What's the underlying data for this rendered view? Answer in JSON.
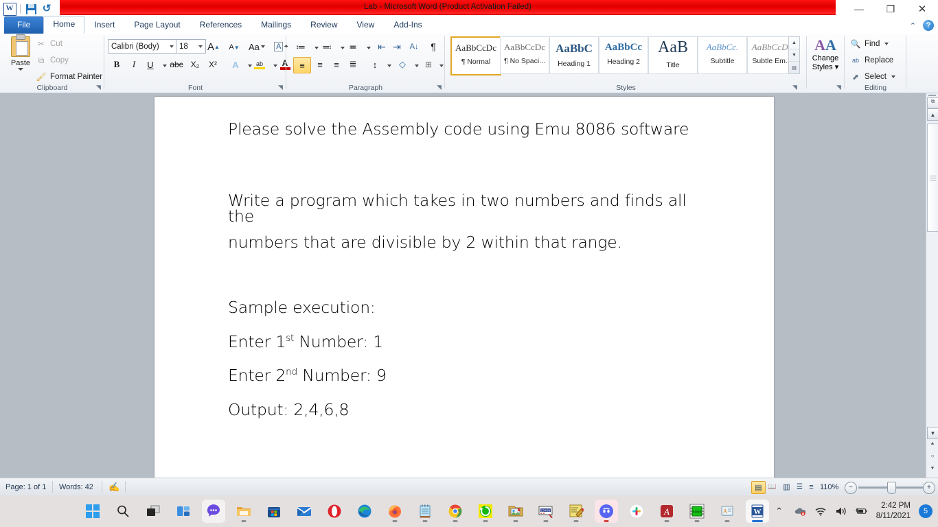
{
  "window": {
    "title": "Lab  -  Microsoft Word (Product Activation Failed)",
    "minimize": "—",
    "restore": "❐",
    "close": "✕",
    "help": "?",
    "collapse_ribbon": "⌃"
  },
  "quick_access": {
    "app_logo": "W",
    "save": "save-icon",
    "undo": "↺",
    "undo_arrow": "▾",
    "redo": "↻",
    "customize": "▾"
  },
  "tabs": [
    {
      "label": "File",
      "kind": "file"
    },
    {
      "label": "Home",
      "kind": "active"
    },
    {
      "label": "Insert",
      "kind": "normal"
    },
    {
      "label": "Page Layout",
      "kind": "normal"
    },
    {
      "label": "References",
      "kind": "normal"
    },
    {
      "label": "Mailings",
      "kind": "normal"
    },
    {
      "label": "Review",
      "kind": "normal"
    },
    {
      "label": "View",
      "kind": "normal"
    },
    {
      "label": "Add-Ins",
      "kind": "normal"
    }
  ],
  "ribbon": {
    "clipboard": {
      "group_label": "Clipboard",
      "paste": "Paste",
      "paste_arrow": "▾",
      "cut": "Cut",
      "copy": "Copy",
      "format_painter": "Format Painter",
      "dialog_launcher": "◥"
    },
    "font": {
      "group_label": "Font",
      "font_name": "Calibri (Body)",
      "font_size": "18",
      "grow_font": "A",
      "shrink_font": "A",
      "change_case": "Aa",
      "clear_formatting": "A",
      "bold": "B",
      "italic": "I",
      "underline": "U",
      "strikethrough": "abc",
      "subscript": "X₂",
      "superscript": "X²",
      "text_effects": "A",
      "highlight": "ab",
      "font_color": "A",
      "dialog_launcher": "◥"
    },
    "paragraph": {
      "group_label": "Paragraph",
      "bullets": "≔",
      "numbering": "≕",
      "multilevel": "≖",
      "decrease_indent": "⇤",
      "increase_indent": "⇥",
      "sort": "A↓",
      "show_marks": "¶",
      "align_left": "≡",
      "align_center": "≡",
      "align_right": "≡",
      "justify": "≣",
      "line_spacing": "↕",
      "shading": "◇",
      "borders": "⊞",
      "dialog_launcher": "◥"
    },
    "styles": {
      "group_label": "Styles",
      "items": [
        {
          "preview": "AaBbCcDc",
          "name": "¶ Normal",
          "selected": true,
          "color": "#2b2b2b",
          "size": "13px",
          "bold": false
        },
        {
          "preview": "AaBbCcDc",
          "name": "¶ No Spaci...",
          "selected": false,
          "color": "#2b2b2b",
          "size": "13px",
          "bold": false
        },
        {
          "preview": "AaBbC",
          "name": "Heading 1",
          "selected": false,
          "color": "#28557f",
          "size": "17px",
          "bold": true
        },
        {
          "preview": "AaBbCc",
          "name": "Heading 2",
          "selected": false,
          "color": "#2e6da4",
          "size": "15px",
          "bold": true
        },
        {
          "preview": "AaB",
          "name": "Title",
          "selected": false,
          "color": "#1f3a55",
          "size": "24px",
          "bold": false
        },
        {
          "preview": "AaBbCc.",
          "name": "Subtitle",
          "selected": false,
          "color": "#4a86c5",
          "size": "14px",
          "bold": false
        },
        {
          "preview": "AaBbCcDc",
          "name": "Subtle Em...",
          "selected": false,
          "color": "#7b7b7b",
          "size": "13px",
          "bold": false
        }
      ],
      "scroll_up": "▲",
      "scroll_down": "▼",
      "more": "▤"
    },
    "change_styles": {
      "line1": "Change",
      "line2": "Styles",
      "arrow": "▾",
      "icon": "AA",
      "dialog_launcher": "◥"
    },
    "editing": {
      "group_label": "Editing",
      "find": "Find",
      "find_arrow": "▾",
      "replace": "Replace",
      "select": "Select",
      "select_arrow": "▾"
    }
  },
  "document": {
    "paragraphs": [
      {
        "text": "Please solve the Assembly code using Emu 8086 software",
        "type": "plain"
      },
      {
        "text": "",
        "type": "blank"
      },
      {
        "text": "Write a program which takes in two numbers and finds all the",
        "type": "plain"
      },
      {
        "text": "numbers that are divisible by 2 within that range.",
        "type": "plain"
      },
      {
        "text": "",
        "type": "blank"
      },
      {
        "text": "Sample execution:",
        "type": "plain"
      },
      {
        "text": "Enter 1",
        "sup": "st",
        "tail": " Number: 1",
        "type": "sup"
      },
      {
        "text": "Enter 2",
        "sup": "nd",
        "tail": " Number: 9",
        "type": "sup"
      },
      {
        "text": "Output: 2,4,6,8",
        "type": "plain"
      }
    ]
  },
  "status_bar": {
    "page": "Page: 1 of 1",
    "words": "Words: 42",
    "proofing": "proofing-errors-icon",
    "views": [
      {
        "name": "print-layout",
        "glyph": "▤",
        "selected": true
      },
      {
        "name": "full-screen-reading",
        "glyph": "📖",
        "selected": false
      },
      {
        "name": "web-layout",
        "glyph": "▥",
        "selected": false
      },
      {
        "name": "outline",
        "glyph": "☰",
        "selected": false
      },
      {
        "name": "draft",
        "glyph": "≡",
        "selected": false
      }
    ],
    "zoom": "110%",
    "zoom_out": "−",
    "zoom_in": "+"
  },
  "scrollbar": {
    "up": "▲",
    "down": "▼",
    "previous_page": "⯅",
    "select_browse_object": "○",
    "next_page": "⯆"
  },
  "taskbar": {
    "items": [
      {
        "name": "start",
        "label": "Start",
        "running": false
      },
      {
        "name": "search",
        "label": "Search",
        "running": false
      },
      {
        "name": "task-view",
        "label": "Task View",
        "running": false
      },
      {
        "name": "widgets",
        "label": "Widgets",
        "running": false
      },
      {
        "name": "chat",
        "label": "Chat",
        "running": false,
        "highlight": "light"
      },
      {
        "name": "file-explorer",
        "label": "File Explorer",
        "running": true
      },
      {
        "name": "microsoft-store",
        "label": "Microsoft Store",
        "running": false
      },
      {
        "name": "mail",
        "label": "Mail",
        "running": false
      },
      {
        "name": "opera",
        "label": "Opera",
        "running": false
      },
      {
        "name": "microsoft-edge",
        "label": "Microsoft Edge",
        "running": false
      },
      {
        "name": "firefox",
        "label": "Firefox",
        "running": true
      },
      {
        "name": "notepad",
        "label": "Notepad",
        "running": true
      },
      {
        "name": "google-chrome",
        "label": "Google Chrome",
        "running": true
      },
      {
        "name": "green-app",
        "label": "Recovery App",
        "running": true
      },
      {
        "name": "folder-app",
        "label": "Media Folder",
        "running": true
      },
      {
        "name": "ticket-app",
        "label": "Label Printer",
        "running": true
      },
      {
        "name": "notes-editor",
        "label": "Notes Editor",
        "running": true
      },
      {
        "name": "discord",
        "label": "Discord",
        "running": true,
        "highlight": "pink"
      },
      {
        "name": "slack",
        "label": "Slack",
        "running": false
      },
      {
        "name": "adobe-acrobat",
        "label": "Adobe Acrobat",
        "running": true
      },
      {
        "name": "emu8086",
        "label": "Emu 8086",
        "running": true
      },
      {
        "name": "reader-app",
        "label": "Reader",
        "running": true
      },
      {
        "name": "microsoft-word",
        "label": "Microsoft Word",
        "running": true,
        "active": true,
        "highlight": "light"
      }
    ],
    "tray": {
      "show_hidden": "⌃",
      "onedrive": "onedrive-error-icon",
      "wifi": "wifi-icon",
      "volume": "volume-icon",
      "battery": "battery-charging-icon",
      "time": "2:42 PM",
      "date": "8/11/2021",
      "notification_count": "5"
    }
  },
  "colors": {
    "title_red": "#ee0000",
    "file_blue": "#2a6ac0",
    "accent_gold": "#e3a723",
    "doc_gray": "#b6bdc5"
  }
}
